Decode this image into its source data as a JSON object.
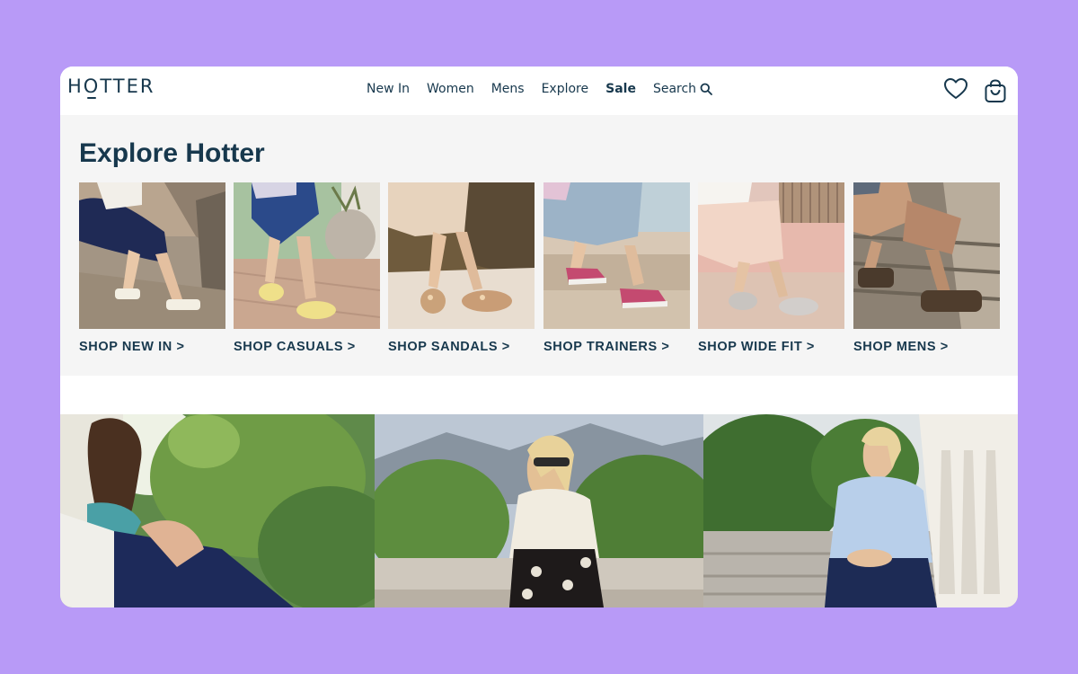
{
  "header": {
    "logo_text": "HOTTER",
    "nav": [
      {
        "label": "New In",
        "bold": false
      },
      {
        "label": "Women",
        "bold": false
      },
      {
        "label": "Mens",
        "bold": false
      },
      {
        "label": "Explore",
        "bold": false
      },
      {
        "label": "Sale",
        "bold": true
      },
      {
        "label": "Search",
        "bold": false
      }
    ],
    "icons": [
      "heart-icon",
      "shopping-bag-icon",
      "search-icon"
    ]
  },
  "explore": {
    "title": "Explore Hotter",
    "tiles": [
      {
        "label": "SHOP NEW IN >",
        "image": "woman-in-navy-skirt-white-sandals-on-rocks"
      },
      {
        "label": "SHOP CASUALS >",
        "image": "woman-in-yellow-mary-jane-shoes"
      },
      {
        "label": "SHOP SANDALS >",
        "image": "woman-in-floral-wedge-sandals"
      },
      {
        "label": "SHOP TRAINERS >",
        "image": "pink-trainers-on-steps"
      },
      {
        "label": "SHOP WIDE FIT >",
        "image": "silver-mary-jane-shoes"
      },
      {
        "label": "SHOP MENS >",
        "image": "man-in-brown-fisherman-sandals"
      }
    ]
  },
  "heroes": [
    {
      "image": "woman-with-scarf-in-garden"
    },
    {
      "image": "woman-in-sunglasses-seated-outdoors"
    },
    {
      "image": "woman-in-blue-shirt-on-steps"
    }
  ],
  "colors": {
    "background": "#b89af7",
    "brand_navy": "#17384d",
    "panel": "#f5f5f5"
  }
}
